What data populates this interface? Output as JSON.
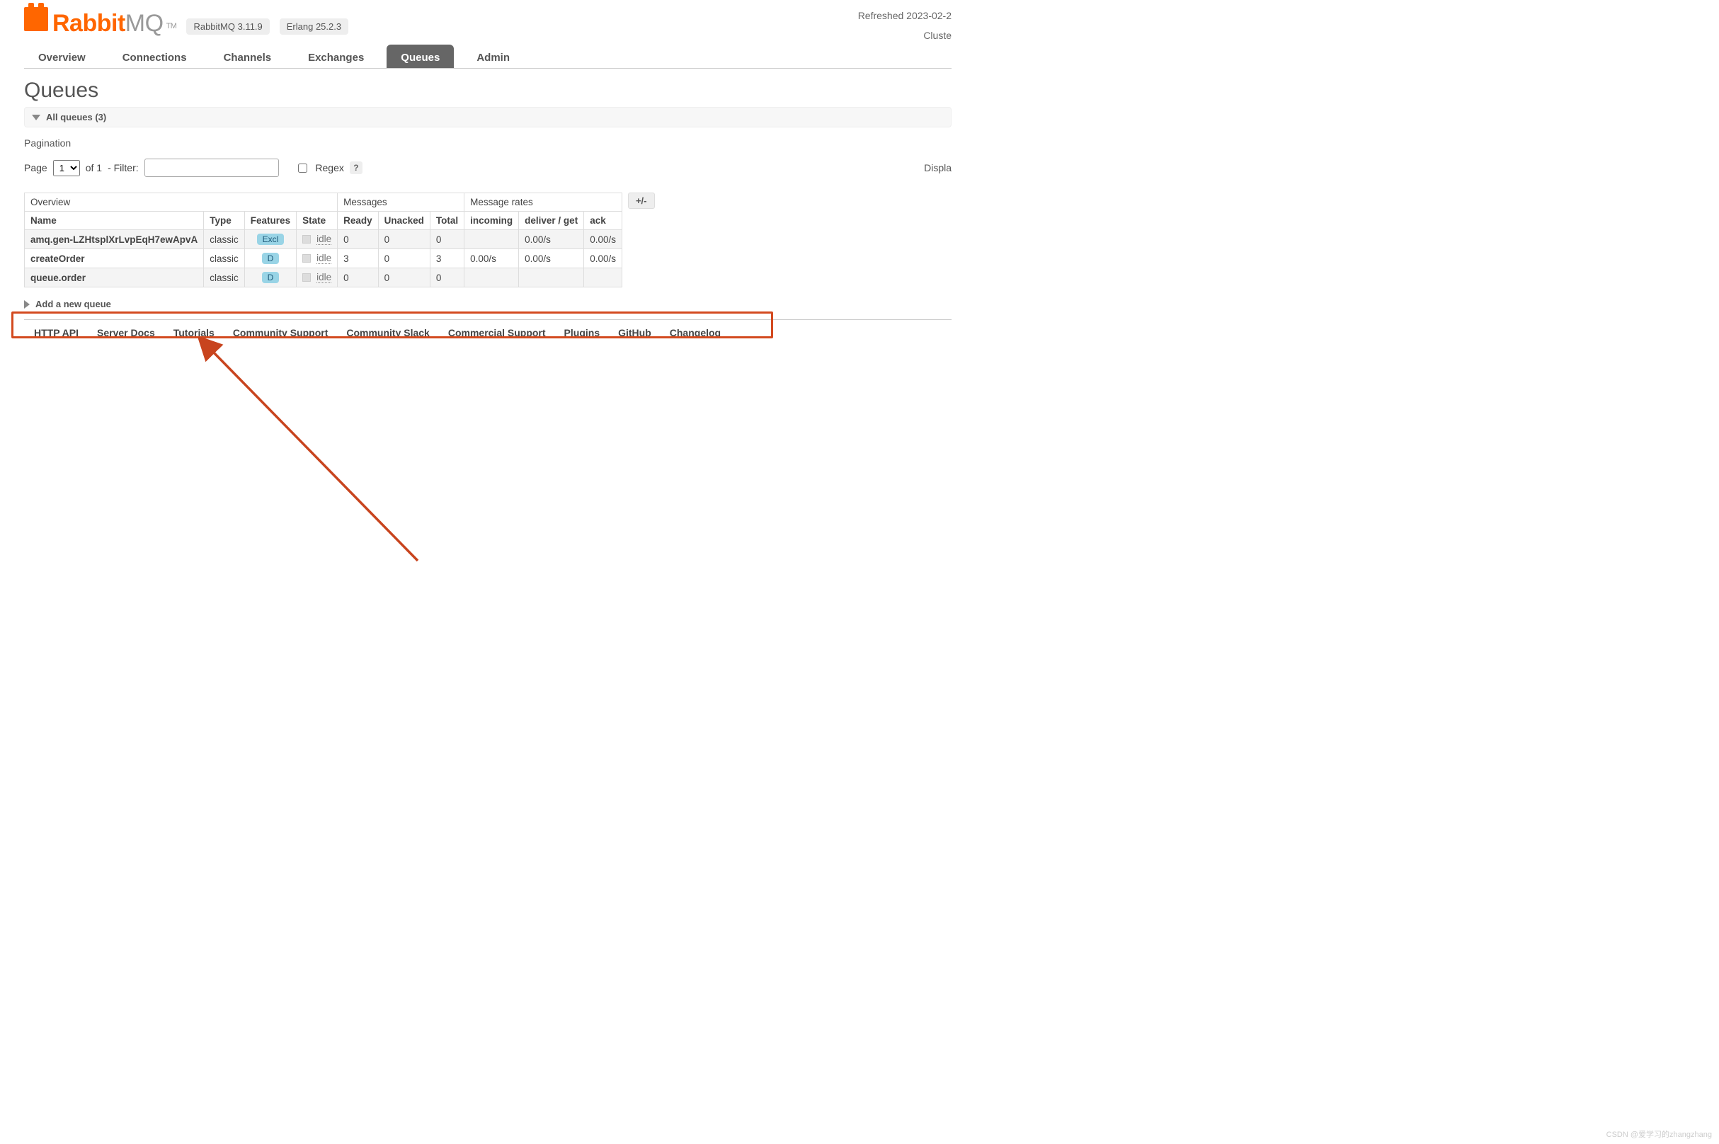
{
  "header": {
    "logo_main": "Rabbit",
    "logo_sub": "MQ",
    "logo_tm": "TM",
    "version_label": "RabbitMQ 3.11.9",
    "erlang_label": "Erlang 25.2.3",
    "refreshed": "Refreshed 2023-02-2",
    "cluster": "Cluste"
  },
  "tabs": [
    {
      "label": "Overview",
      "active": false
    },
    {
      "label": "Connections",
      "active": false
    },
    {
      "label": "Channels",
      "active": false
    },
    {
      "label": "Exchanges",
      "active": false
    },
    {
      "label": "Queues",
      "active": true
    },
    {
      "label": "Admin",
      "active": false
    }
  ],
  "page": {
    "title": "Queues",
    "all_queues_label": "All queues (3)",
    "pagination_label": "Pagination",
    "page_word": "Page",
    "page_select_value": "1",
    "of_pages": "of 1",
    "filter_divider": "- Filter:",
    "filter_value": "",
    "regex_label": "Regex",
    "help_q": "?",
    "displa": "Displa",
    "pm_button": "+/-"
  },
  "table": {
    "group_headers": [
      "Overview",
      "Messages",
      "Message rates"
    ],
    "columns": [
      "Name",
      "Type",
      "Features",
      "State",
      "Ready",
      "Unacked",
      "Total",
      "incoming",
      "deliver / get",
      "ack"
    ],
    "rows": [
      {
        "name": "amq.gen-LZHtsplXrLvpEqH7ewApvA",
        "type": "classic",
        "feature": "Excl",
        "state": "idle",
        "ready": "0",
        "unacked": "0",
        "total": "0",
        "incoming": "",
        "deliver_get": "0.00/s",
        "ack": "0.00/s"
      },
      {
        "name": "createOrder",
        "type": "classic",
        "feature": "D",
        "state": "idle",
        "ready": "3",
        "unacked": "0",
        "total": "3",
        "incoming": "0.00/s",
        "deliver_get": "0.00/s",
        "ack": "0.00/s"
      },
      {
        "name": "queue.order",
        "type": "classic",
        "feature": "D",
        "state": "idle",
        "ready": "0",
        "unacked": "0",
        "total": "0",
        "incoming": "",
        "deliver_get": "",
        "ack": ""
      }
    ]
  },
  "add_queue_label": "Add a new queue",
  "footer": [
    "HTTP API",
    "Server Docs",
    "Tutorials",
    "Community Support",
    "Community Slack",
    "Commercial Support",
    "Plugins",
    "GitHub",
    "Changelog"
  ],
  "watermark": "CSDN @爱学习的zhangzhang"
}
